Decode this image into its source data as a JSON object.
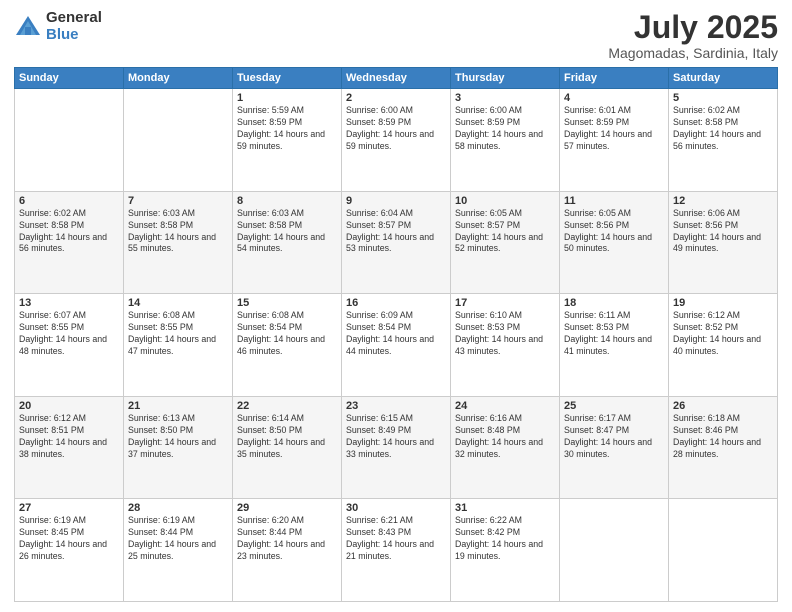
{
  "logo": {
    "general": "General",
    "blue": "Blue"
  },
  "header": {
    "month": "July 2025",
    "location": "Magomadas, Sardinia, Italy"
  },
  "weekdays": [
    "Sunday",
    "Monday",
    "Tuesday",
    "Wednesday",
    "Thursday",
    "Friday",
    "Saturday"
  ],
  "weeks": [
    [
      {
        "day": "",
        "sunrise": "",
        "sunset": "",
        "daylight": ""
      },
      {
        "day": "",
        "sunrise": "",
        "sunset": "",
        "daylight": ""
      },
      {
        "day": "1",
        "sunrise": "Sunrise: 5:59 AM",
        "sunset": "Sunset: 8:59 PM",
        "daylight": "Daylight: 14 hours and 59 minutes."
      },
      {
        "day": "2",
        "sunrise": "Sunrise: 6:00 AM",
        "sunset": "Sunset: 8:59 PM",
        "daylight": "Daylight: 14 hours and 59 minutes."
      },
      {
        "day": "3",
        "sunrise": "Sunrise: 6:00 AM",
        "sunset": "Sunset: 8:59 PM",
        "daylight": "Daylight: 14 hours and 58 minutes."
      },
      {
        "day": "4",
        "sunrise": "Sunrise: 6:01 AM",
        "sunset": "Sunset: 8:59 PM",
        "daylight": "Daylight: 14 hours and 57 minutes."
      },
      {
        "day": "5",
        "sunrise": "Sunrise: 6:02 AM",
        "sunset": "Sunset: 8:58 PM",
        "daylight": "Daylight: 14 hours and 56 minutes."
      }
    ],
    [
      {
        "day": "6",
        "sunrise": "Sunrise: 6:02 AM",
        "sunset": "Sunset: 8:58 PM",
        "daylight": "Daylight: 14 hours and 56 minutes."
      },
      {
        "day": "7",
        "sunrise": "Sunrise: 6:03 AM",
        "sunset": "Sunset: 8:58 PM",
        "daylight": "Daylight: 14 hours and 55 minutes."
      },
      {
        "day": "8",
        "sunrise": "Sunrise: 6:03 AM",
        "sunset": "Sunset: 8:58 PM",
        "daylight": "Daylight: 14 hours and 54 minutes."
      },
      {
        "day": "9",
        "sunrise": "Sunrise: 6:04 AM",
        "sunset": "Sunset: 8:57 PM",
        "daylight": "Daylight: 14 hours and 53 minutes."
      },
      {
        "day": "10",
        "sunrise": "Sunrise: 6:05 AM",
        "sunset": "Sunset: 8:57 PM",
        "daylight": "Daylight: 14 hours and 52 minutes."
      },
      {
        "day": "11",
        "sunrise": "Sunrise: 6:05 AM",
        "sunset": "Sunset: 8:56 PM",
        "daylight": "Daylight: 14 hours and 50 minutes."
      },
      {
        "day": "12",
        "sunrise": "Sunrise: 6:06 AM",
        "sunset": "Sunset: 8:56 PM",
        "daylight": "Daylight: 14 hours and 49 minutes."
      }
    ],
    [
      {
        "day": "13",
        "sunrise": "Sunrise: 6:07 AM",
        "sunset": "Sunset: 8:55 PM",
        "daylight": "Daylight: 14 hours and 48 minutes."
      },
      {
        "day": "14",
        "sunrise": "Sunrise: 6:08 AM",
        "sunset": "Sunset: 8:55 PM",
        "daylight": "Daylight: 14 hours and 47 minutes."
      },
      {
        "day": "15",
        "sunrise": "Sunrise: 6:08 AM",
        "sunset": "Sunset: 8:54 PM",
        "daylight": "Daylight: 14 hours and 46 minutes."
      },
      {
        "day": "16",
        "sunrise": "Sunrise: 6:09 AM",
        "sunset": "Sunset: 8:54 PM",
        "daylight": "Daylight: 14 hours and 44 minutes."
      },
      {
        "day": "17",
        "sunrise": "Sunrise: 6:10 AM",
        "sunset": "Sunset: 8:53 PM",
        "daylight": "Daylight: 14 hours and 43 minutes."
      },
      {
        "day": "18",
        "sunrise": "Sunrise: 6:11 AM",
        "sunset": "Sunset: 8:53 PM",
        "daylight": "Daylight: 14 hours and 41 minutes."
      },
      {
        "day": "19",
        "sunrise": "Sunrise: 6:12 AM",
        "sunset": "Sunset: 8:52 PM",
        "daylight": "Daylight: 14 hours and 40 minutes."
      }
    ],
    [
      {
        "day": "20",
        "sunrise": "Sunrise: 6:12 AM",
        "sunset": "Sunset: 8:51 PM",
        "daylight": "Daylight: 14 hours and 38 minutes."
      },
      {
        "day": "21",
        "sunrise": "Sunrise: 6:13 AM",
        "sunset": "Sunset: 8:50 PM",
        "daylight": "Daylight: 14 hours and 37 minutes."
      },
      {
        "day": "22",
        "sunrise": "Sunrise: 6:14 AM",
        "sunset": "Sunset: 8:50 PM",
        "daylight": "Daylight: 14 hours and 35 minutes."
      },
      {
        "day": "23",
        "sunrise": "Sunrise: 6:15 AM",
        "sunset": "Sunset: 8:49 PM",
        "daylight": "Daylight: 14 hours and 33 minutes."
      },
      {
        "day": "24",
        "sunrise": "Sunrise: 6:16 AM",
        "sunset": "Sunset: 8:48 PM",
        "daylight": "Daylight: 14 hours and 32 minutes."
      },
      {
        "day": "25",
        "sunrise": "Sunrise: 6:17 AM",
        "sunset": "Sunset: 8:47 PM",
        "daylight": "Daylight: 14 hours and 30 minutes."
      },
      {
        "day": "26",
        "sunrise": "Sunrise: 6:18 AM",
        "sunset": "Sunset: 8:46 PM",
        "daylight": "Daylight: 14 hours and 28 minutes."
      }
    ],
    [
      {
        "day": "27",
        "sunrise": "Sunrise: 6:19 AM",
        "sunset": "Sunset: 8:45 PM",
        "daylight": "Daylight: 14 hours and 26 minutes."
      },
      {
        "day": "28",
        "sunrise": "Sunrise: 6:19 AM",
        "sunset": "Sunset: 8:44 PM",
        "daylight": "Daylight: 14 hours and 25 minutes."
      },
      {
        "day": "29",
        "sunrise": "Sunrise: 6:20 AM",
        "sunset": "Sunset: 8:44 PM",
        "daylight": "Daylight: 14 hours and 23 minutes."
      },
      {
        "day": "30",
        "sunrise": "Sunrise: 6:21 AM",
        "sunset": "Sunset: 8:43 PM",
        "daylight": "Daylight: 14 hours and 21 minutes."
      },
      {
        "day": "31",
        "sunrise": "Sunrise: 6:22 AM",
        "sunset": "Sunset: 8:42 PM",
        "daylight": "Daylight: 14 hours and 19 minutes."
      },
      {
        "day": "",
        "sunrise": "",
        "sunset": "",
        "daylight": ""
      },
      {
        "day": "",
        "sunrise": "",
        "sunset": "",
        "daylight": ""
      }
    ]
  ]
}
